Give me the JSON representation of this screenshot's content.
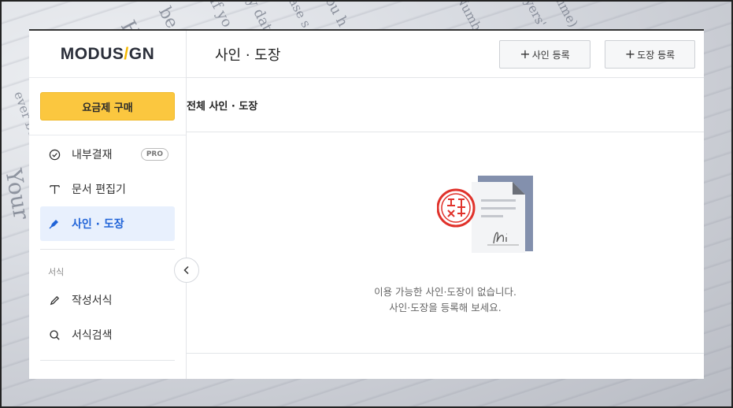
{
  "app": {
    "logo": {
      "part1": "MODUS",
      "slash": "/",
      "part2": "GN"
    }
  },
  "sidebar": {
    "buy_button": "요금제 구매",
    "items": [
      {
        "label": "내부결재",
        "badge": "PRO",
        "icon": "check-circle-icon"
      },
      {
        "label": "문서 편집기",
        "icon": "text-icon"
      },
      {
        "label": "사인 · 도장",
        "icon": "pen-nib-icon",
        "active": true
      }
    ],
    "section_label": "서식",
    "section_items": [
      {
        "label": "작성서식",
        "icon": "pencil-icon"
      },
      {
        "label": "서식검색",
        "icon": "search-icon"
      }
    ]
  },
  "header": {
    "title": "사인 · 도장",
    "add_sign_button": "사인 등록",
    "add_stamp_button": "도장 등록"
  },
  "content": {
    "subtitle": "전체 사인 · 도장",
    "empty_line1": "이용 가능한 사인·도장이 없습니다.",
    "empty_line2": "사인·도장을 등록해 보세요."
  },
  "colors": {
    "accent_yellow": "#fbc73f",
    "active_blue": "#2164d8",
    "active_bg": "#e8f0fd",
    "stamp_red": "#e0322b"
  }
}
